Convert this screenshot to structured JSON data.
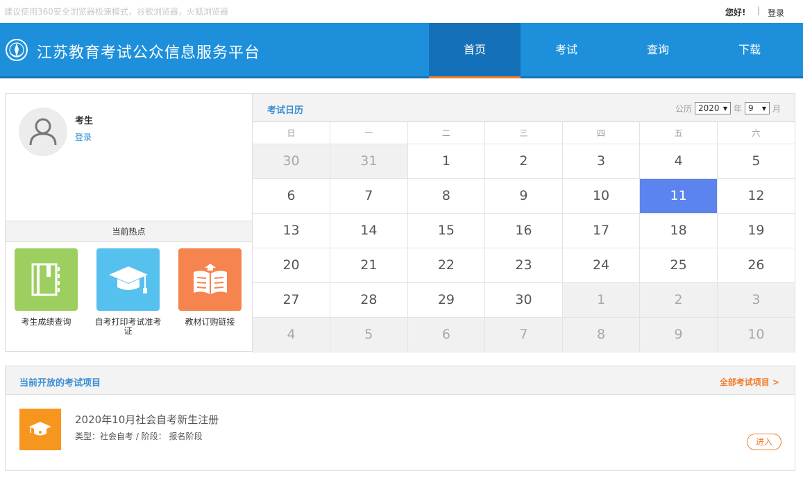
{
  "topbar": {
    "tip": "建议使用360安全浏览器极速模式，谷歌浏览器，火狐浏览器",
    "hello": "您好!",
    "separator": "|",
    "login": "登录"
  },
  "header": {
    "site_title": "江苏教育考试公众信息服务平台",
    "nav": [
      {
        "label": "首页",
        "active": true
      },
      {
        "label": "考试",
        "active": false
      },
      {
        "label": "查询",
        "active": false
      },
      {
        "label": "下载",
        "active": false
      }
    ]
  },
  "user": {
    "name": "考生",
    "login_link": "登录"
  },
  "hot": {
    "title": "当前热点",
    "items": [
      {
        "label": "考生成绩查询",
        "icon": "book-icon",
        "color": "#9ccf5f"
      },
      {
        "label": "自考打印考试准考证",
        "icon": "graduation-cap-icon",
        "color": "#56c0ee"
      },
      {
        "label": "教材订购链接",
        "icon": "open-book-icon",
        "color": "#f6844f"
      }
    ]
  },
  "calendar": {
    "title": "考试日历",
    "era_label": "公历",
    "year": "2020",
    "year_unit": "年",
    "month": "9",
    "month_unit": "月",
    "weekdays": [
      "日",
      "一",
      "二",
      "三",
      "四",
      "五",
      "六"
    ],
    "today": 11,
    "rows": [
      [
        {
          "d": "30",
          "other": true
        },
        {
          "d": "31",
          "other": true
        },
        {
          "d": "1"
        },
        {
          "d": "2"
        },
        {
          "d": "3"
        },
        {
          "d": "4"
        },
        {
          "d": "5"
        }
      ],
      [
        {
          "d": "6"
        },
        {
          "d": "7"
        },
        {
          "d": "8"
        },
        {
          "d": "9"
        },
        {
          "d": "10"
        },
        {
          "d": "11",
          "today": true
        },
        {
          "d": "12"
        }
      ],
      [
        {
          "d": "13"
        },
        {
          "d": "14"
        },
        {
          "d": "15"
        },
        {
          "d": "16"
        },
        {
          "d": "17"
        },
        {
          "d": "18"
        },
        {
          "d": "19"
        }
      ],
      [
        {
          "d": "20"
        },
        {
          "d": "21"
        },
        {
          "d": "22"
        },
        {
          "d": "23"
        },
        {
          "d": "24"
        },
        {
          "d": "25"
        },
        {
          "d": "26"
        }
      ],
      [
        {
          "d": "27"
        },
        {
          "d": "28"
        },
        {
          "d": "29"
        },
        {
          "d": "30"
        },
        {
          "d": "1",
          "other": true
        },
        {
          "d": "2",
          "other": true
        },
        {
          "d": "3",
          "other": true
        }
      ],
      [
        {
          "d": "4",
          "other": true
        },
        {
          "d": "5",
          "other": true
        },
        {
          "d": "6",
          "other": true
        },
        {
          "d": "7",
          "other": true
        },
        {
          "d": "8",
          "other": true
        },
        {
          "d": "9",
          "other": true
        },
        {
          "d": "10",
          "other": true
        }
      ]
    ]
  },
  "exams": {
    "title": "当前开放的考试项目",
    "all_link": "全部考试项目 >",
    "items": [
      {
        "name": "2020年10月社会自考新生注册",
        "meta": "类型：社会自考 / 阶段： 报名阶段",
        "enter": "进入"
      }
    ]
  },
  "colors": {
    "header_blue": "#1e90db",
    "nav_active": "#1470b8",
    "accent_orange": "#f27c2c",
    "title_blue": "#3a8ed4",
    "today_blue": "#5b84ef"
  }
}
